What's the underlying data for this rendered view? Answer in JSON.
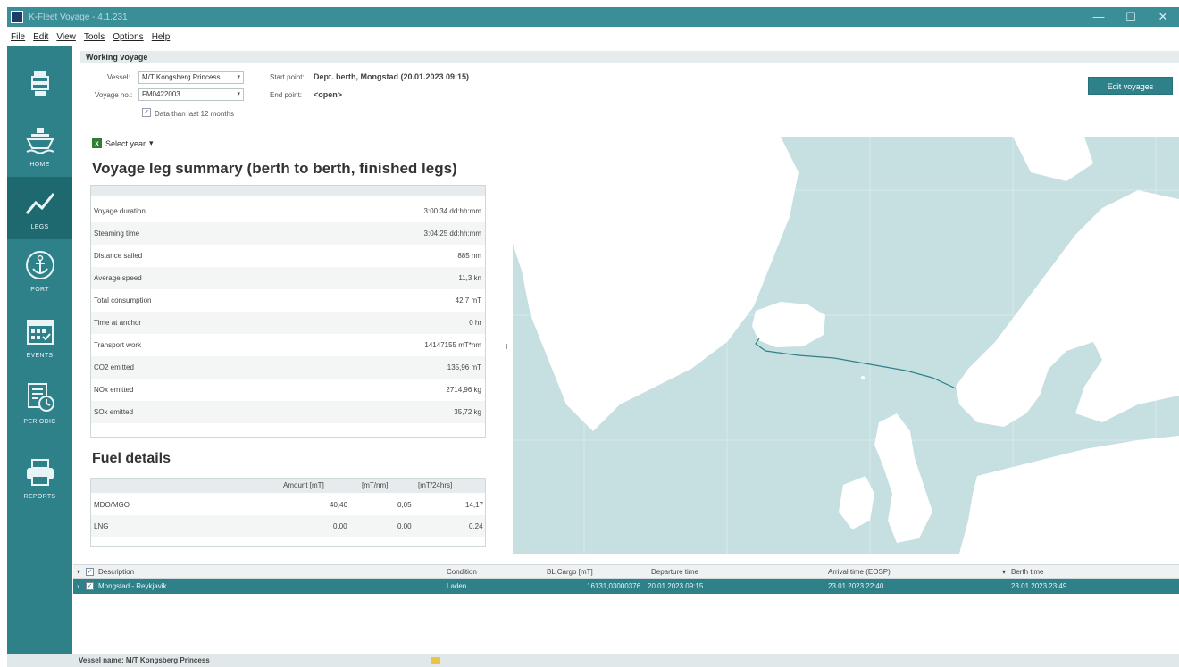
{
  "window": {
    "title": "K-Fleet Voyage - 4.1.231",
    "controls": [
      "—",
      "☐",
      "✕"
    ]
  },
  "menu": [
    "File",
    "Edit",
    "View",
    "Tools",
    "Options",
    "Help"
  ],
  "sidebar": {
    "items": [
      {
        "label": "",
        "icon": "emblem-icon"
      },
      {
        "label": "HOME",
        "icon": "ship-icon"
      },
      {
        "label": "LEGS",
        "icon": "chart-line-icon",
        "active": true
      },
      {
        "label": "PORT",
        "icon": "anchor-icon"
      },
      {
        "label": "EVENTS",
        "icon": "calendar-icon"
      },
      {
        "label": "PERIODIC",
        "icon": "document-clock-icon"
      },
      {
        "label": "REPORTS",
        "icon": "printer-icon"
      }
    ]
  },
  "working_voyage": {
    "header": "Working voyage",
    "vessel_label": "Vessel:",
    "vessel_value": "M/T Kongsberg Princess",
    "voyage_label": "Voyage no.:",
    "voyage_value": "FM0422003",
    "checkbox_label": "Data than last 12 months",
    "start_label": "Start point:",
    "start_value": "Dept. berth, Mongstad (20.01.2023 09:15)",
    "end_label": "End point:",
    "end_value": "<open>",
    "edit_button": "Edit voyages"
  },
  "select_year": "Select year",
  "summary": {
    "title": "Voyage leg summary (berth to berth, finished legs)",
    "rows": [
      {
        "k": "Voyage duration",
        "v": "3:00:34 dd:hh:mm"
      },
      {
        "k": "Steaming time",
        "v": "3:04:25 dd:hh:mm"
      },
      {
        "k": "Distance sailed",
        "v": "885 nm"
      },
      {
        "k": "Average speed",
        "v": "11,3 kn"
      },
      {
        "k": "Total consumption",
        "v": "42,7 mT"
      },
      {
        "k": "Time at anchor",
        "v": "0 hr"
      },
      {
        "k": "Transport work",
        "v": "14147155 mT*nm"
      },
      {
        "k": "CO2 emitted",
        "v": "135,96 mT"
      },
      {
        "k": "NOx emitted",
        "v": "2714,96 kg"
      },
      {
        "k": "SOx emitted",
        "v": "35,72 kg"
      }
    ]
  },
  "fuel": {
    "title": "Fuel details",
    "headers": [
      "Amount [mT]",
      "[mT/nm]",
      "[mT/24hrs]"
    ],
    "rows": [
      {
        "name": "MDO/MGO",
        "amount": "40,40",
        "per_nm": "0,05",
        "per_day": "14,17"
      },
      {
        "name": "LNG",
        "amount": "0,00",
        "per_nm": "0,00",
        "per_day": "0,24"
      }
    ]
  },
  "grid": {
    "headers": [
      "Description",
      "Condition",
      "BL Cargo [mT]",
      "Departure time",
      "Arrival time (EOSP)",
      "Berth time"
    ],
    "rows": [
      {
        "description": "Mongstad - Reykjavik",
        "condition": "Laden",
        "cargo": "16131,03000376",
        "departure": "20.01.2023 09:15",
        "arrival": "23.01.2023 22:40",
        "berth": "23.01.2023 23:49"
      }
    ]
  },
  "status": {
    "vessel_name": "Vessel name: M/T Kongsberg Princess"
  },
  "colors": {
    "accent": "#2f8189",
    "map_sea": "#c6dfe1",
    "map_land": "#ffffff",
    "route": "#2f8189"
  }
}
